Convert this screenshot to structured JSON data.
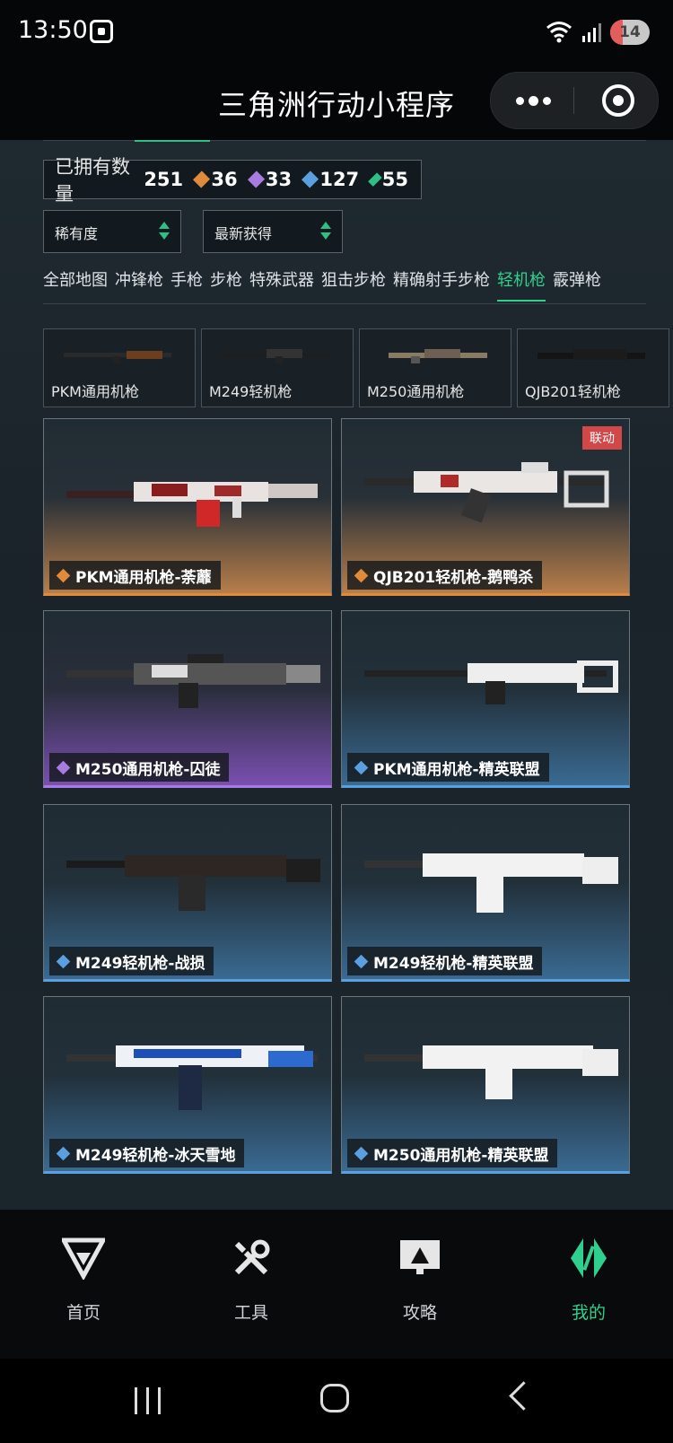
{
  "status": {
    "time": "13:50",
    "battery": "14"
  },
  "app": {
    "title": "三角洲行动小程序"
  },
  "owned": {
    "label": "已拥有数量",
    "total": "251",
    "counts": [
      {
        "value": "36",
        "color": "#e08a3a",
        "icon": "orange-diamond-icon"
      },
      {
        "value": "33",
        "color": "#a77be0",
        "icon": "purple-diamond-icon"
      },
      {
        "value": "127",
        "color": "#5aa0e0",
        "icon": "blue-diamond-icon"
      },
      {
        "value": "55",
        "color": "#2fbf84",
        "icon": "green-diamond-icon"
      }
    ]
  },
  "filters": {
    "rarity": "稀有度",
    "sort": "最新获得"
  },
  "tabs": [
    "全部地图",
    "冲锋枪",
    "手枪",
    "步枪",
    "特殊武器",
    "狙击步枪",
    "精确射手步枪",
    "轻机枪",
    "霰弹枪"
  ],
  "active_tab": "轻机枪",
  "subtabs": [
    "PKM通用机枪",
    "M249轻机枪",
    "M250通用机枪",
    "QJB201轻机枪"
  ],
  "cards": [
    {
      "label": "PKM通用机枪-荼蘼",
      "rarity": "orange",
      "badge": ""
    },
    {
      "label": "QJB201轻机枪-鹅鸭杀",
      "rarity": "orange",
      "badge": "联动"
    },
    {
      "label": "M250通用机枪-囚徒",
      "rarity": "purple",
      "badge": ""
    },
    {
      "label": "PKM通用机枪-精英联盟",
      "rarity": "blue",
      "badge": ""
    },
    {
      "label": "M249轻机枪-战损",
      "rarity": "blue",
      "badge": ""
    },
    {
      "label": "M249轻机枪-精英联盟",
      "rarity": "blue",
      "badge": ""
    },
    {
      "label": "M249轻机枪-冰天雪地",
      "rarity": "blue",
      "badge": ""
    },
    {
      "label": "M250通用机枪-精英联盟",
      "rarity": "blue",
      "badge": ""
    }
  ],
  "nav": [
    {
      "label": "首页",
      "icon": "home-logo-icon"
    },
    {
      "label": "工具",
      "icon": "tools-icon"
    },
    {
      "label": "攻略",
      "icon": "guide-monitor-icon"
    },
    {
      "label": "我的",
      "icon": "mine-logo-icon"
    }
  ],
  "colors": {
    "accent": "#2fd08d",
    "orange": "#e08a3a",
    "purple": "#a77be0",
    "blue": "#5aa0e0"
  }
}
